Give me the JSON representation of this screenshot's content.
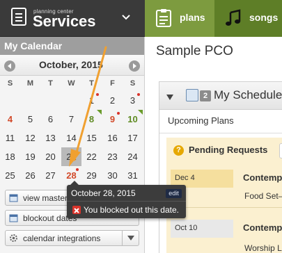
{
  "brand": {
    "small": "planning center",
    "name": "Services"
  },
  "tabs": [
    {
      "label": "plans"
    },
    {
      "label": "songs"
    }
  ],
  "sidebar": {
    "title": "My Calendar",
    "month": "October, 2015",
    "weekdays": [
      "S",
      "M",
      "T",
      "W",
      "T",
      "F",
      "S"
    ],
    "weeks": [
      [
        "",
        "",
        "",
        "",
        "1",
        "2",
        "3"
      ],
      [
        "4",
        "5",
        "6",
        "7",
        "8",
        "9",
        "10"
      ],
      [
        "11",
        "12",
        "13",
        "14",
        "15",
        "16",
        "17"
      ],
      [
        "18",
        "19",
        "20",
        "21",
        "22",
        "23",
        "24"
      ],
      [
        "25",
        "26",
        "27",
        "28",
        "29",
        "30",
        "31"
      ]
    ],
    "buttons": {
      "view_master": "view master",
      "blockout": "blockout dates",
      "integrations": "calendar integrations"
    }
  },
  "main": {
    "title": "Sample PCO",
    "panel_title": "My Schedule",
    "badge": "2",
    "upcoming": "Upcoming Plans",
    "pending_title": "Pending Requests",
    "requests": [
      {
        "date": "Dec 4",
        "title": "Contemp",
        "sub": "Food Set–"
      },
      {
        "date": "Oct 10",
        "title": "Contemp",
        "sub": "Worship L"
      }
    ]
  },
  "tooltip": {
    "date": "October 28, 2015",
    "edit": "edit",
    "message": "You blocked out this date."
  },
  "colors": {
    "accent_green": "#7d9b3f",
    "alert_red": "#d9342b",
    "arrow_orange": "#f0a030"
  }
}
